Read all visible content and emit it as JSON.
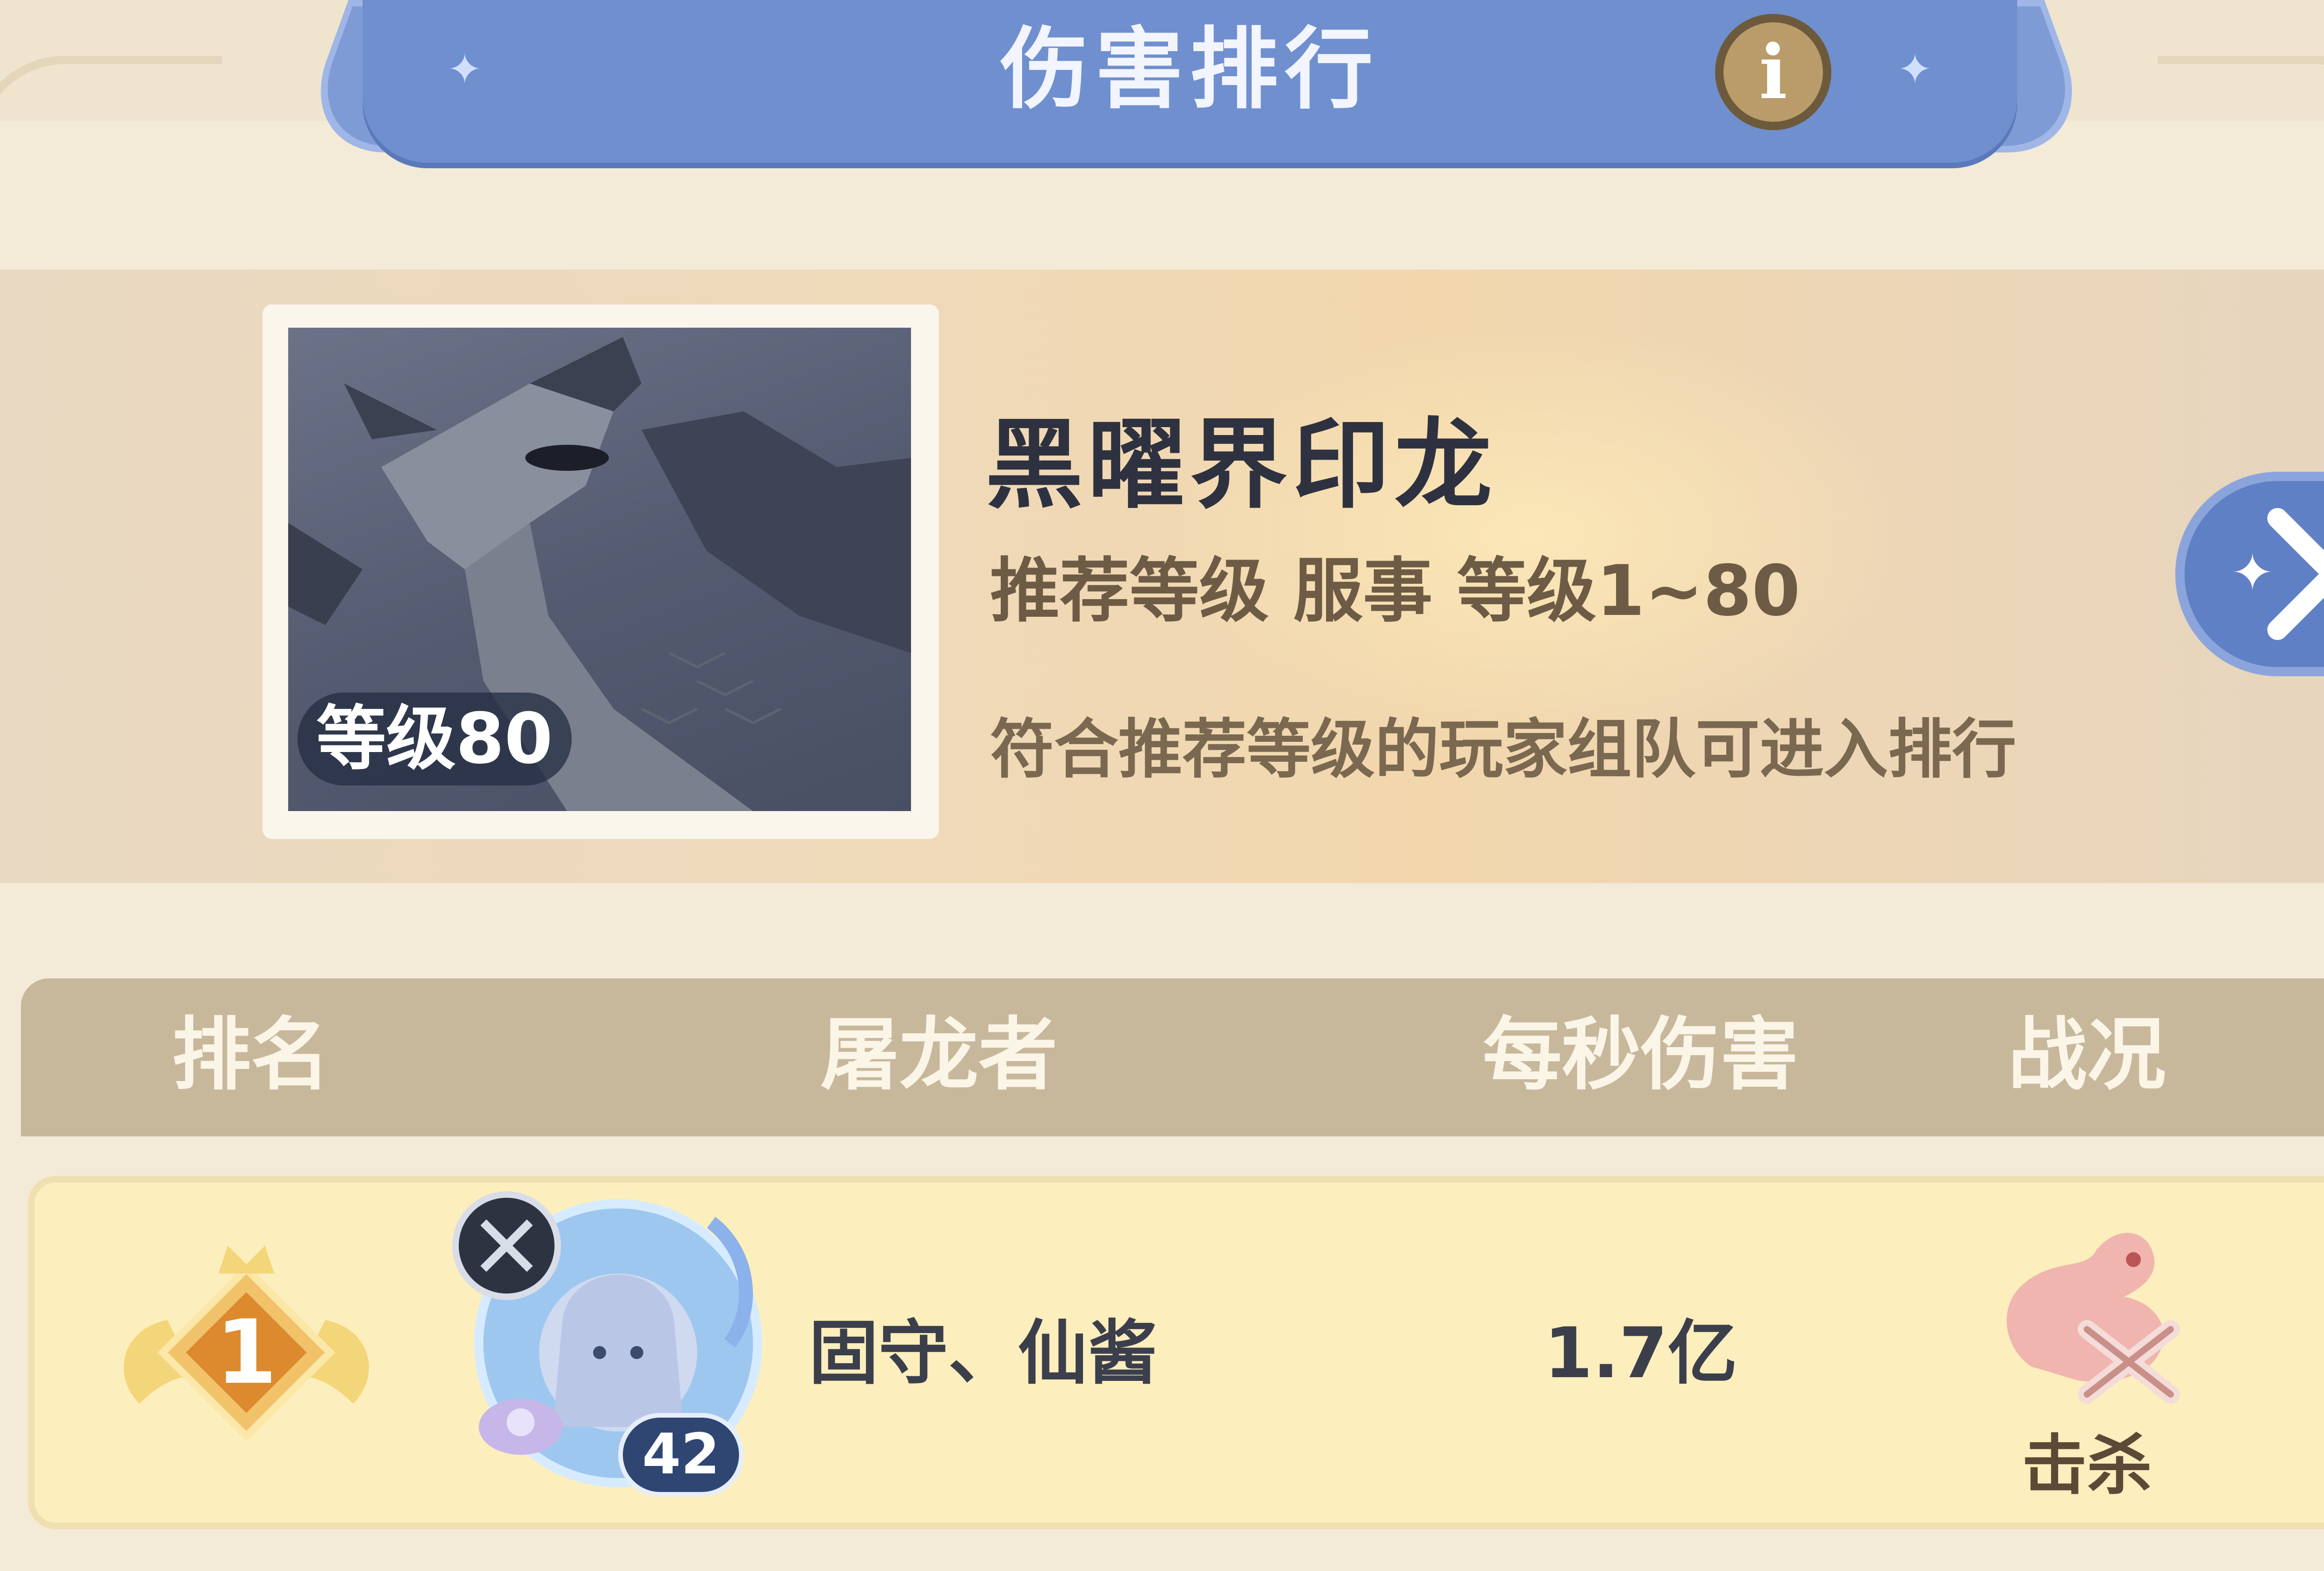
{
  "header": {
    "title": "伤害排行",
    "info_icon": "i"
  },
  "boss": {
    "name": "黑曜界印龙",
    "level_badge": "等级80",
    "recommend": "推荐等级 服事  等级1~80",
    "note": "符合推荐等级的玩家组队可进入排行"
  },
  "table": {
    "columns": [
      "排名",
      "屠龙者",
      "每秒伤害",
      "战况"
    ],
    "rows": [
      {
        "rank": "1",
        "player_name": "固守、仙酱",
        "player_level": "42",
        "dps": "1.7亿",
        "result": "击杀"
      }
    ]
  },
  "colors": {
    "title_band": "#6f8fcf",
    "table_header": "#c8b89b",
    "row_bg": "#fdeebd",
    "rank_gold": "#e39a36"
  }
}
